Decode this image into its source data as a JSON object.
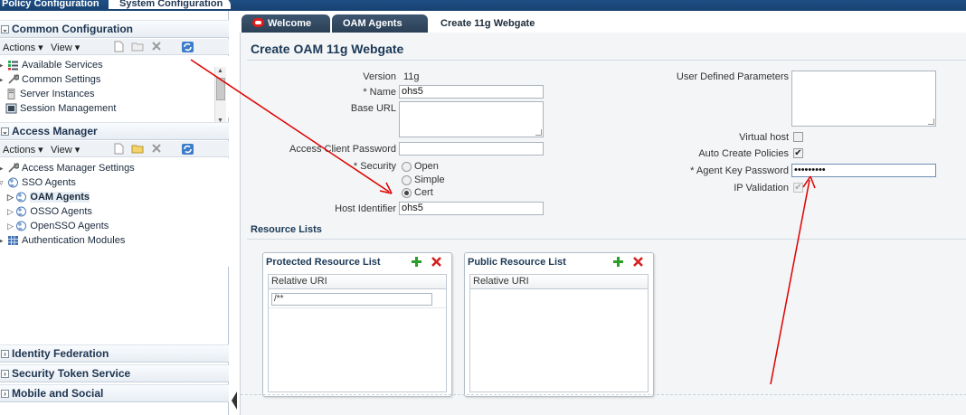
{
  "top_tabs": {
    "policy": "Policy Configuration",
    "system": "System Configuration"
  },
  "sidebar": {
    "common_config": {
      "title": "Common Configuration",
      "actions_label": "Actions ▾",
      "view_label": "View ▾",
      "items": [
        "Available Services",
        "Common Settings",
        "Server Instances",
        "Session Management"
      ]
    },
    "access_manager": {
      "title": "Access Manager",
      "actions_label": "Actions ▾",
      "view_label": "View ▾",
      "items": [
        "Access Manager Settings",
        "SSO Agents",
        "OAM Agents",
        "OSSO Agents",
        "OpenSSO Agents",
        "Authentication Modules"
      ]
    },
    "identity_federation": "Identity Federation",
    "security_token": "Security Token Service",
    "mobile_social": "Mobile and Social"
  },
  "tabs": [
    {
      "label": "Welcome"
    },
    {
      "label": "OAM Agents"
    },
    {
      "label": "Create 11g Webgate"
    }
  ],
  "form": {
    "title": "Create OAM 11g Webgate",
    "version_label": "Version",
    "version_value": "11g",
    "name_label": "* Name",
    "name_value": "ohs5",
    "base_url_label": "Base URL",
    "access_client_password_label": "Access Client Password",
    "security_label": "* Security",
    "security_options": [
      "Open",
      "Simple",
      "Cert"
    ],
    "security_selected": "Cert",
    "host_identifier_label": "Host Identifier",
    "host_identifier_value": "ohs5",
    "user_defined_parameters_label": "User Defined Parameters",
    "virtual_host_label": "Virtual host",
    "auto_create_policies_label": "Auto Create Policies",
    "agent_key_password_label": "* Agent Key Password",
    "agent_key_password_value": "•••••••••",
    "ip_validation_label": "IP Validation"
  },
  "resource_lists": {
    "title": "Resource Lists",
    "protected": {
      "title": "Protected Resource List",
      "column": "Relative URI",
      "rows": [
        "/**"
      ]
    },
    "public": {
      "title": "Public Resource List",
      "column": "Relative URI",
      "rows": []
    }
  },
  "colors": {
    "annotation_arrow": "#e00000",
    "header_blue": "#1f4f86"
  }
}
